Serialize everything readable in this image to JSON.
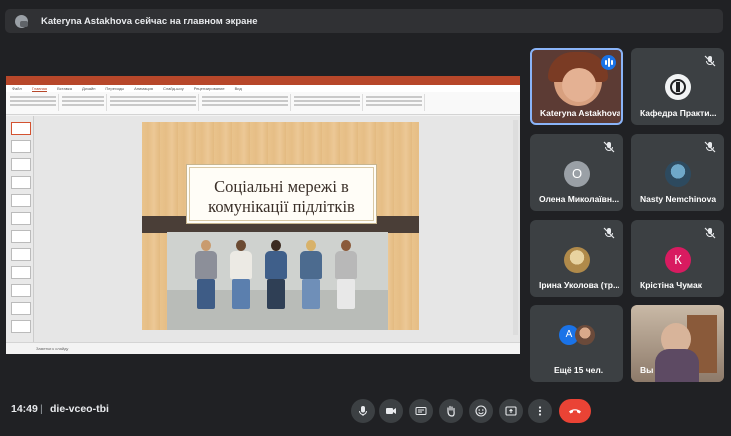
{
  "banner": {
    "text": "Kateryna Astakhova сейчас на главном экране",
    "icon": "presenter-icon"
  },
  "presentation": {
    "slide_title_line1": "Соціальні мережі в",
    "slide_title_line2": "комунікації підлітків",
    "status_text": "Заметки к слайду",
    "app_accent": "#b7472a",
    "ribbon_tabs": [
      "Файл",
      "Главная",
      "Вставка",
      "Дизайн",
      "Переходы",
      "Анимация",
      "Слайд-шоу",
      "Рецензирование",
      "Вид"
    ]
  },
  "participants": [
    {
      "name": "Kateryna Astakhova",
      "speaking": true
    },
    {
      "name": "Кафедра Практи...",
      "muted": true,
      "avatar": "emblem-logo"
    },
    {
      "name": "Олена Миколаївн...",
      "muted": true,
      "initial": "О",
      "color": "#9aa0a6"
    },
    {
      "name": "Nasty Nemchinova",
      "muted": true,
      "avatar": "photo"
    },
    {
      "name": "Ірина Уколова (тр...",
      "muted": true,
      "avatar": "photo"
    },
    {
      "name": "Крістіна Чумак",
      "muted": true,
      "initial": "К",
      "color": "#d81b60"
    },
    {
      "name": "Ещё 15 чел.",
      "initial": "А",
      "color": "#1a73e8"
    },
    {
      "name": "Вы"
    }
  ],
  "meeting": {
    "time": "14:49",
    "separator": "|",
    "code": "die-vceo-tbi"
  },
  "controls": [
    "microphone-icon",
    "camera-icon",
    "captions-icon",
    "raise-hand-icon",
    "emoji-icon",
    "present-icon",
    "more-icon",
    "hangup-icon"
  ],
  "colors": {
    "background": "#202124",
    "tile": "#3c4043",
    "hangup": "#ea4335",
    "active_speaker": "#1a73e8"
  }
}
